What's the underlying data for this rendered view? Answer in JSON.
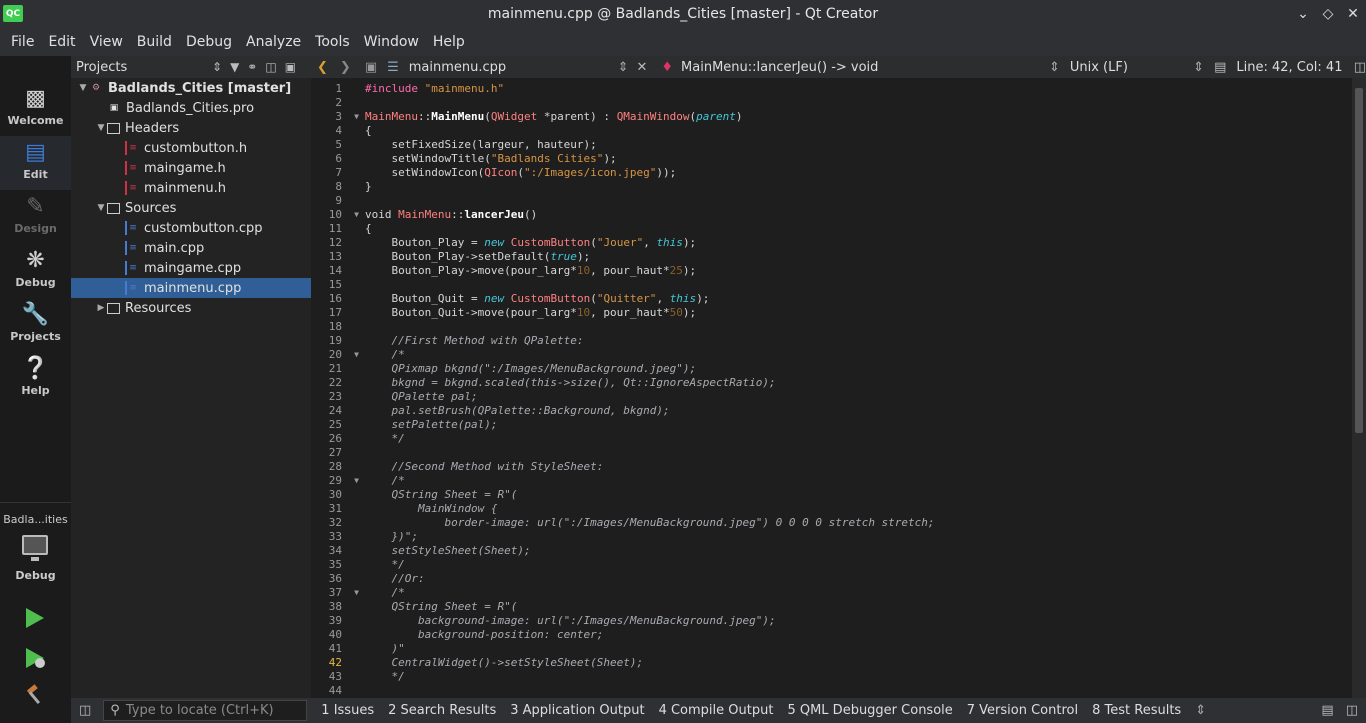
{
  "window": {
    "title": "mainmenu.cpp @ Badlands_Cities [master] - Qt Creator",
    "logo": "QC"
  },
  "menu": [
    "File",
    "Edit",
    "View",
    "Build",
    "Debug",
    "Analyze",
    "Tools",
    "Window",
    "Help"
  ],
  "modes": [
    {
      "label": "Welcome",
      "icon": "grid-icon"
    },
    {
      "label": "Edit",
      "icon": "document-icon"
    },
    {
      "label": "Design",
      "icon": "pencil-icon"
    },
    {
      "label": "Debug",
      "icon": "bug-icon"
    },
    {
      "label": "Projects",
      "icon": "wrench-icon"
    },
    {
      "label": "Help",
      "icon": "help-icon"
    }
  ],
  "kit": {
    "project": "Badla...ities",
    "build": "Debug"
  },
  "projects_pane": {
    "title": "Projects",
    "tree": [
      {
        "label": "Badlands_Cities [master]",
        "level": 0,
        "expanded": true,
        "kind": "proj",
        "bold": true
      },
      {
        "label": "Badlands_Cities.pro",
        "level": 1,
        "kind": "pro"
      },
      {
        "label": "Headers",
        "level": 1,
        "expanded": true,
        "kind": "folder"
      },
      {
        "label": "custombutton.h",
        "level": 2,
        "kind": "h"
      },
      {
        "label": "maingame.h",
        "level": 2,
        "kind": "h"
      },
      {
        "label": "mainmenu.h",
        "level": 2,
        "kind": "h"
      },
      {
        "label": "Sources",
        "level": 1,
        "expanded": true,
        "kind": "folder"
      },
      {
        "label": "custombutton.cpp",
        "level": 2,
        "kind": "cpp"
      },
      {
        "label": "main.cpp",
        "level": 2,
        "kind": "cpp"
      },
      {
        "label": "maingame.cpp",
        "level": 2,
        "kind": "cpp"
      },
      {
        "label": "mainmenu.cpp",
        "level": 2,
        "kind": "cpp",
        "selected": true
      },
      {
        "label": "Resources",
        "level": 1,
        "expanded": false,
        "kind": "folder"
      }
    ]
  },
  "editor_toolbar": {
    "file": "mainmenu.cpp",
    "symbol": "MainMenu::lancerJeu() -> void",
    "line_ending": "Unix (LF)",
    "position": "Line: 42, Col: 41"
  },
  "editor": {
    "current_line": 42,
    "fold_lines": [
      3,
      10,
      20,
      29,
      37
    ],
    "lines": [
      [
        [
          "pp",
          "#include"
        ],
        [
          "str",
          " \"mainmenu.h\""
        ]
      ],
      [],
      [
        [
          "cls",
          "MainMenu"
        ],
        [
          "",
          "::"
        ],
        [
          "fn",
          "MainMenu"
        ],
        [
          "",
          "("
        ],
        [
          "cls",
          "QWidget"
        ],
        [
          "",
          " *parent) : "
        ],
        [
          "cls",
          "QMainWindow"
        ],
        [
          "",
          "("
        ],
        [
          "kw",
          "parent"
        ],
        [
          "",
          ")"
        ]
      ],
      [
        [
          "",
          "{"
        ]
      ],
      [
        [
          "",
          "    setFixedSize(largeur, hauteur);"
        ]
      ],
      [
        [
          "",
          "    setWindowTitle("
        ],
        [
          "str",
          "\"Badlands Cities\""
        ],
        [
          "",
          ");"
        ]
      ],
      [
        [
          "",
          "    setWindowIcon("
        ],
        [
          "cls",
          "QIcon"
        ],
        [
          "",
          "("
        ],
        [
          "str",
          "\":/Images/icon.jpeg\""
        ],
        [
          "",
          "));"
        ]
      ],
      [
        [
          "",
          "}"
        ]
      ],
      [],
      [
        [
          "",
          "void "
        ],
        [
          "cls",
          "MainMenu"
        ],
        [
          "",
          "::"
        ],
        [
          "fn",
          "lancerJeu"
        ],
        [
          "",
          "()"
        ]
      ],
      [
        [
          "",
          "{"
        ]
      ],
      [
        [
          "",
          "    Bouton_Play = "
        ],
        [
          "kw",
          "new"
        ],
        [
          "",
          " "
        ],
        [
          "cls",
          "CustomButton"
        ],
        [
          "",
          "("
        ],
        [
          "str",
          "\"Jouer\""
        ],
        [
          "",
          ", "
        ],
        [
          "kw",
          "this"
        ],
        [
          "",
          ");"
        ]
      ],
      [
        [
          "",
          "    Bouton_Play->setDefault("
        ],
        [
          "kw",
          "true"
        ],
        [
          "",
          ");"
        ]
      ],
      [
        [
          "",
          "    Bouton_Play->move(pour_larg*"
        ],
        [
          "num",
          "10"
        ],
        [
          "",
          ", pour_haut*"
        ],
        [
          "num",
          "25"
        ],
        [
          "",
          ");"
        ]
      ],
      [],
      [
        [
          "",
          "    Bouton_Quit = "
        ],
        [
          "kw",
          "new"
        ],
        [
          "",
          " "
        ],
        [
          "cls",
          "CustomButton"
        ],
        [
          "",
          "("
        ],
        [
          "str",
          "\"Quitter\""
        ],
        [
          "",
          ", "
        ],
        [
          "kw",
          "this"
        ],
        [
          "",
          ");"
        ]
      ],
      [
        [
          "",
          "    Bouton_Quit->move(pour_larg*"
        ],
        [
          "num",
          "10"
        ],
        [
          "",
          ", pour_haut*"
        ],
        [
          "num",
          "50"
        ],
        [
          "",
          ");"
        ]
      ],
      [],
      [
        [
          "cm",
          "    //First Method with QPalette:"
        ]
      ],
      [
        [
          "cm",
          "    /*"
        ]
      ],
      [
        [
          "cm",
          "    QPixmap bkgnd(\":/Images/MenuBackground.jpeg\");"
        ]
      ],
      [
        [
          "cm",
          "    bkgnd = bkgnd.scaled(this->size(), Qt::IgnoreAspectRatio);"
        ]
      ],
      [
        [
          "cm",
          "    QPalette pal;"
        ]
      ],
      [
        [
          "cm",
          "    pal.setBrush(QPalette::Background, bkgnd);"
        ]
      ],
      [
        [
          "cm",
          "    setPalette(pal);"
        ]
      ],
      [
        [
          "cm",
          "    */"
        ]
      ],
      [],
      [
        [
          "cm",
          "    //Second Method with StyleSheet:"
        ]
      ],
      [
        [
          "cm",
          "    /*"
        ]
      ],
      [
        [
          "cm",
          "    QString Sheet = R\"("
        ]
      ],
      [
        [
          "cm",
          "        MainWindow {"
        ]
      ],
      [
        [
          "cm",
          "            border-image: url(\":/Images/MenuBackground.jpeg\") 0 0 0 0 stretch stretch;"
        ]
      ],
      [
        [
          "cm",
          "    })\";"
        ]
      ],
      [
        [
          "cm",
          "    setStyleSheet(Sheet);"
        ]
      ],
      [
        [
          "cm",
          "    */"
        ]
      ],
      [
        [
          "cm",
          "    //Or:"
        ]
      ],
      [
        [
          "cm",
          "    /*"
        ]
      ],
      [
        [
          "cm",
          "    QString Sheet = R\"("
        ]
      ],
      [
        [
          "cm",
          "        background-image: url(\":/Images/MenuBackground.jpeg\");"
        ]
      ],
      [
        [
          "cm",
          "        background-position: center;"
        ]
      ],
      [
        [
          "cm",
          "    )\""
        ]
      ],
      [
        [
          "cm",
          "    CentralWidget()->setStyleSheet(Sheet);"
        ]
      ],
      [
        [
          "cm",
          "    */"
        ]
      ],
      []
    ]
  },
  "bottom_bar": {
    "locator_placeholder": "Type to locate (Ctrl+K)",
    "tabs": [
      "1  Issues",
      "2  Search Results",
      "3  Application Output",
      "4  Compile Output",
      "5  QML Debugger Console",
      "7  Version Control",
      "8  Test Results"
    ]
  }
}
